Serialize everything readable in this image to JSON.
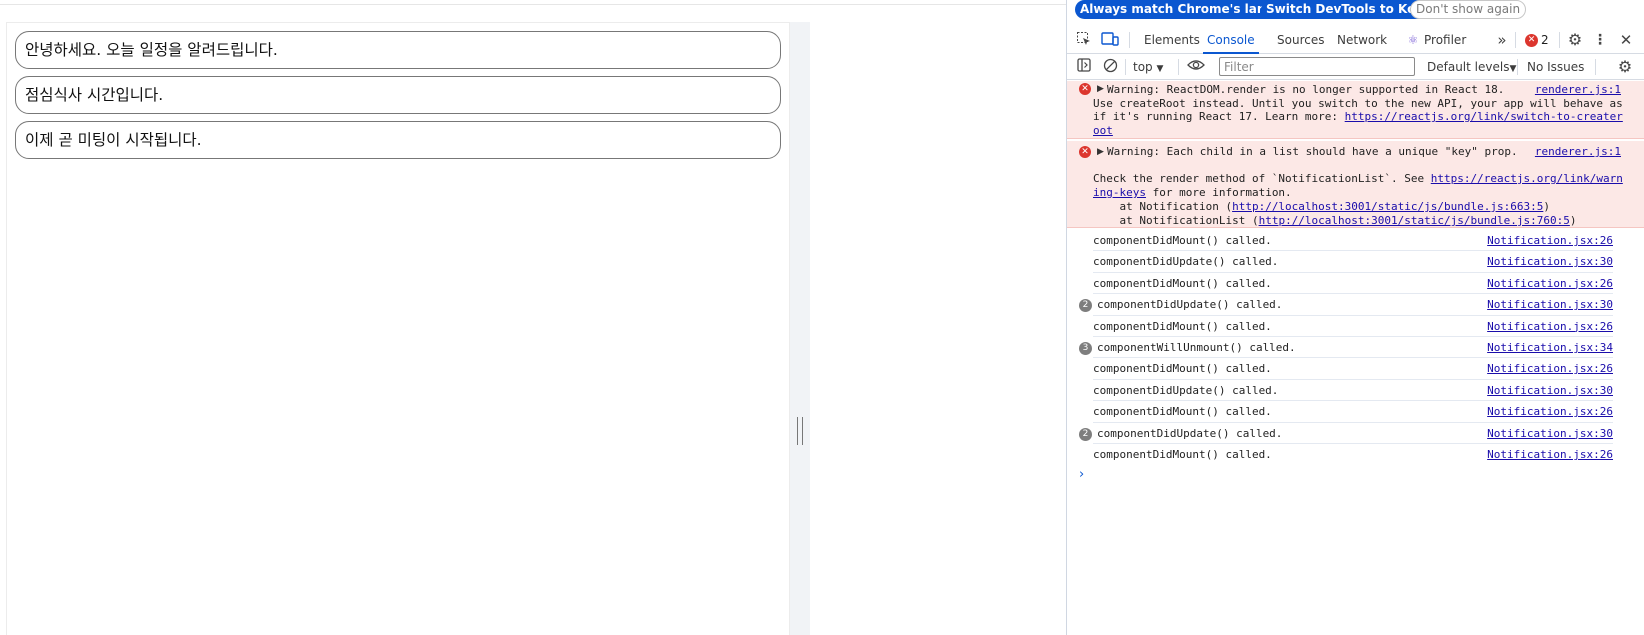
{
  "page": {
    "notifications": [
      "안녕하세요. 오늘 일정을 알려드립니다.",
      "점심식사 시간입니다.",
      "이제 곧 미팅이 시작됩니다."
    ]
  },
  "devtools": {
    "lang_bar": {
      "match_language": "Always match Chrome's language",
      "switch_korean": "Switch DevTools to Korean",
      "dont_show": "Don't show again"
    },
    "tabs": [
      "Elements",
      "Console",
      "Sources",
      "Network",
      "Profiler"
    ],
    "active_tab": "Console",
    "error_count": "2",
    "toolbar": {
      "context": "top",
      "filter_placeholder": "Filter",
      "levels": "Default levels",
      "issues": "No Issues"
    },
    "errors": [
      {
        "lines": [
          "Warning: ReactDOM.render is no longer supported in React 18.",
          "Use createRoot instead. Until you switch to the new API, your app will behave as",
          "if it's running React 17. Learn more: ",
          "oot"
        ],
        "link1": "https://reactjs.org/link/switch-to-creater",
        "source": "renderer.js:1"
      },
      {
        "line1": "Warning: Each child in a list should have a unique \"key\" prop.",
        "line2": "Check the render method of `NotificationList`. See ",
        "link_a": "https://reactjs.org/link/warn",
        "link_b": "ing-keys",
        "line3_tail": " for more information.",
        "at1_pre": "    at Notification (",
        "at1_link": "http://localhost:3001/static/js/bundle.js:663:5",
        "at2_pre": "    at NotificationList (",
        "at2_link": "http://localhost:3001/static/js/bundle.js:760:5",
        "close": ")",
        "source": "renderer.js:1"
      }
    ],
    "logs": [
      {
        "text": "componentDidMount() called.",
        "source": "Notification.jsx:26",
        "count": ""
      },
      {
        "text": "componentDidUpdate() called.",
        "source": "Notification.jsx:30",
        "count": ""
      },
      {
        "text": "componentDidMount() called.",
        "source": "Notification.jsx:26",
        "count": ""
      },
      {
        "text": "componentDidUpdate() called.",
        "source": "Notification.jsx:30",
        "count": "2"
      },
      {
        "text": "componentDidMount() called.",
        "source": "Notification.jsx:26",
        "count": ""
      },
      {
        "text": "componentWillUnmount() called.",
        "source": "Notification.jsx:34",
        "count": "3"
      },
      {
        "text": "componentDidMount() called.",
        "source": "Notification.jsx:26",
        "count": ""
      },
      {
        "text": "componentDidUpdate() called.",
        "source": "Notification.jsx:30",
        "count": ""
      },
      {
        "text": "componentDidMount() called.",
        "source": "Notification.jsx:26",
        "count": ""
      },
      {
        "text": "componentDidUpdate() called.",
        "source": "Notification.jsx:30",
        "count": "2"
      },
      {
        "text": "componentDidMount() called.",
        "source": "Notification.jsx:26",
        "count": ""
      }
    ],
    "prompt_symbol": "›"
  }
}
